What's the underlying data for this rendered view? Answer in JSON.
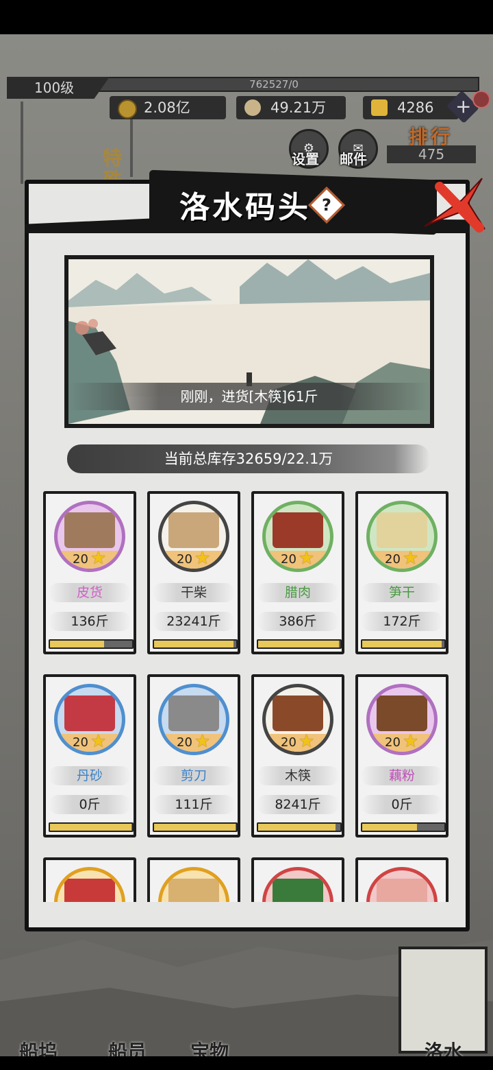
{
  "hud": {
    "level": "100级",
    "exp": "762527/0",
    "coins": "2.08亿",
    "silver": "49.21万",
    "gold": "4286"
  },
  "buttons": {
    "settings": "设置",
    "mail": "邮件",
    "rank_title": "排行",
    "rank_value": "475"
  },
  "side": {
    "special": "特殊"
  },
  "dialog": {
    "title": "洛水码头",
    "help": "?",
    "log": "刚刚，进货[木筷]61斤",
    "stock": "当前总库存32659/22.1万"
  },
  "goods": [
    {
      "name": "皮货",
      "level": "20",
      "amount": "136斤",
      "progress": 0.66,
      "name_color": "#d060c8",
      "ring": "#b070c0",
      "art": "#a07a5c",
      "bg": "#e9c6ec"
    },
    {
      "name": "干柴",
      "level": "20",
      "amount": "23241斤",
      "progress": 0.97,
      "name_color": "#333333",
      "ring": "#444444",
      "art": "#c9a77a",
      "bg": "#f4f1ea"
    },
    {
      "name": "腊肉",
      "level": "20",
      "amount": "386斤",
      "progress": 0.98,
      "name_color": "#4a9a42",
      "ring": "#6fb062",
      "art": "#9c3a2a",
      "bg": "#cfe6c4"
    },
    {
      "name": "笋干",
      "level": "20",
      "amount": "172斤",
      "progress": 0.97,
      "name_color": "#4a9a42",
      "ring": "#6fb062",
      "art": "#e2d39c",
      "bg": "#cfe6c4"
    },
    {
      "name": "丹砂",
      "level": "20",
      "amount": "0斤",
      "progress": 0.99,
      "name_color": "#3a82c8",
      "ring": "#4f8fcf",
      "art": "#c43a44",
      "bg": "#c6daf0"
    },
    {
      "name": "剪刀",
      "level": "20",
      "amount": "111斤",
      "progress": 0.99,
      "name_color": "#3a82c8",
      "ring": "#4f8fcf",
      "art": "#8a8a8a",
      "bg": "#c6daf0"
    },
    {
      "name": "木筷",
      "level": "20",
      "amount": "8241斤",
      "progress": 0.94,
      "name_color": "#333333",
      "ring": "#444444",
      "art": "#8a4a2a",
      "bg": "#f4f1ea"
    },
    {
      "name": "藕粉",
      "level": "20",
      "amount": "0斤",
      "progress": 0.67,
      "name_color": "#c050b8",
      "ring": "#b070c0",
      "art": "#7a4a2a",
      "bg": "#e9c6ec"
    },
    {
      "name": "",
      "level": "",
      "amount": "",
      "progress": 0,
      "name_color": "#333333",
      "ring": "#e0a020",
      "art": "#c83a3a",
      "bg": "#f7e2b0"
    },
    {
      "name": "",
      "level": "",
      "amount": "",
      "progress": 0,
      "name_color": "#333333",
      "ring": "#e0a020",
      "art": "#d8b070",
      "bg": "#f7e2b0"
    },
    {
      "name": "",
      "level": "",
      "amount": "",
      "progress": 0,
      "name_color": "#333333",
      "ring": "#d04444",
      "art": "#3a7a3a",
      "bg": "#f2c8c8"
    },
    {
      "name": "",
      "level": "",
      "amount": "",
      "progress": 0,
      "name_color": "#333333",
      "ring": "#d04444",
      "art": "#e8a8a0",
      "bg": "#f2c8c8"
    }
  ],
  "bottom": {
    "tab1": "船坞",
    "tab2": "船员",
    "tab3": "宝物",
    "tab4": "洛水"
  }
}
